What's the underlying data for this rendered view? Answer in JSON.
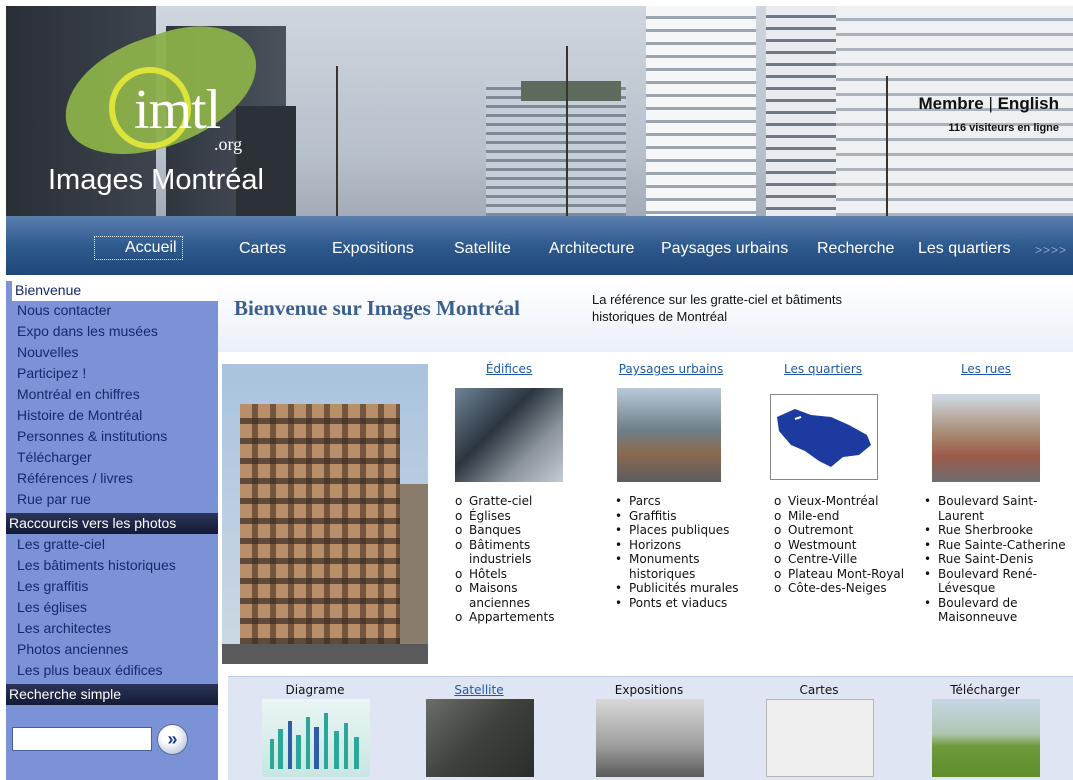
{
  "header": {
    "logo_text": "mtl",
    "logo_org": ".org",
    "site_name": "Images Montréal",
    "member_label": "Membre",
    "separator": "|",
    "english_label": "English",
    "visitors": "116 visiteurs en ligne"
  },
  "nav": {
    "items": [
      "Accueil",
      "Cartes",
      "Expositions",
      "Satellite",
      "Architecture",
      "Paysages urbains",
      "Recherche",
      "Les quartiers"
    ],
    "more": ">>>>"
  },
  "sidebar": {
    "links": [
      "Bienvenue",
      "Nous contacter",
      "Expo dans les musées",
      "Nouvelles",
      "Participez !",
      "Montréal en chiffres",
      "Histoire de Montréal",
      "Personnes & institutions",
      "Télécharger",
      "Références / livres",
      "Rue par rue"
    ],
    "shortcuts_heading": "Raccourcis vers les photos",
    "shortcuts": [
      "Les gratte-ciel",
      "Les bâtiments historiques",
      "Les graffitis",
      "Les églises",
      "Les architectes",
      "Photos anciennes",
      "Les plus beaux édifices"
    ],
    "search_heading": "Recherche simple",
    "search_value": "",
    "search_button": "»"
  },
  "welcome": {
    "title": "Bienvenue sur Images Montréal",
    "subtitle": "La référence sur les gratte-ciel et bâtiments historiques de Montréal"
  },
  "categories": [
    {
      "title": "Édifices",
      "icon": "building-photo",
      "items": [
        "Gratte-ciel",
        "Églises",
        "Banques",
        "Bâtiments industriels",
        "Hôtels",
        "Maisons anciennes",
        "Appartements"
      ]
    },
    {
      "title": "Paysages urbains",
      "icon": "street-photo",
      "items": [
        "Parcs",
        "Graffitis",
        "Places publiques",
        "Horizons",
        "Monuments historiques",
        "Publicités murales",
        "Ponts et viaducs"
      ]
    },
    {
      "title": "Les quartiers",
      "icon": "island-map",
      "items": [
        "Vieux-Montréal",
        "Mile-end",
        "Outremont",
        "Westmount",
        "Centre-Ville",
        "Plateau Mont-Royal",
        "Côte-des-Neiges"
      ]
    },
    {
      "title": "Les rues",
      "icon": "street-corner-photo",
      "items": [
        "Boulevard Saint-Laurent",
        "Rue Sherbrooke",
        "Rue Sainte-Catherine",
        "Rue Saint-Denis",
        "Boulevard René-Lévesque",
        "Boulevard de Maisonneuve"
      ]
    }
  ],
  "bottom": [
    {
      "label": "Diagrame",
      "link": false
    },
    {
      "label": "Satellite",
      "link": true
    },
    {
      "label": "Expositions",
      "link": false
    },
    {
      "label": "Cartes",
      "link": false
    },
    {
      "label": "Télécharger",
      "link": false
    }
  ],
  "colors": {
    "nav_bg": "#2f5a8e",
    "sidebar_bg": "#7b93d6",
    "sidebar_link": "#13296b",
    "heading_bg": "#141a35",
    "link": "#1e5aa8",
    "title": "#3b5f8e",
    "logo_ring": "#dde33b",
    "island": "#8cb04a"
  }
}
